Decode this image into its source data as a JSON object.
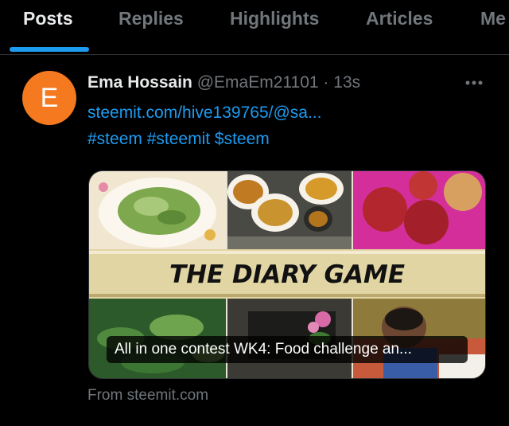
{
  "tabs": [
    {
      "label": "Posts",
      "active": true
    },
    {
      "label": "Replies"
    },
    {
      "label": "Highlights"
    },
    {
      "label": "Articles"
    },
    {
      "label": "Me"
    }
  ],
  "post": {
    "avatar_letter": "E",
    "avatar_color": "#f4791f",
    "author_name": "Ema Hossain",
    "handle": "@EmaEm21101",
    "separator": "·",
    "time": "13s",
    "link": "steemit.com/hive139765/@sa...",
    "hashtags": "#steem #steemit $steem",
    "card": {
      "banner_text": "THE DIARY GAME",
      "caption": "All in one contest WK4: Food challenge an...",
      "source": "From steemit.com"
    }
  },
  "colors": {
    "accent": "#1d9bf0",
    "muted": "#71767b",
    "text": "#e7e9ea",
    "background": "#000000"
  },
  "icons": {
    "more": "more-horizontal-icon"
  }
}
